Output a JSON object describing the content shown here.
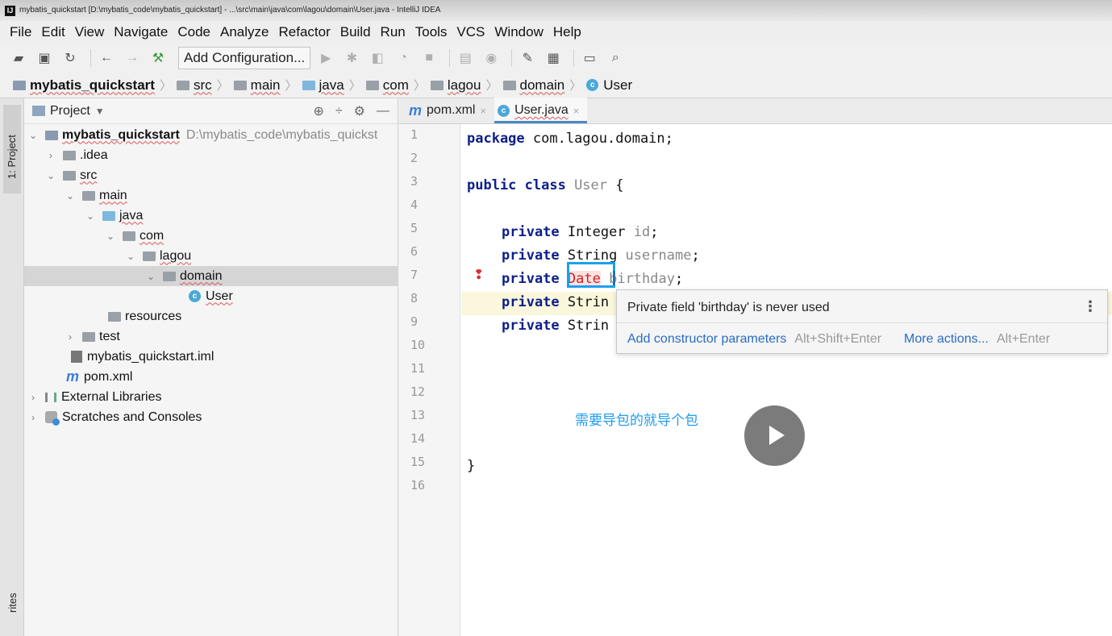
{
  "window": {
    "title": "mybatis_quickstart [D:\\mybatis_code\\mybatis_quickstart] - ...\\src\\main\\java\\com\\lagou\\domain\\User.java - IntelliJ IDEA"
  },
  "menu": [
    "File",
    "Edit",
    "View",
    "Navigate",
    "Code",
    "Analyze",
    "Refactor",
    "Build",
    "Run",
    "Tools",
    "VCS",
    "Window",
    "Help"
  ],
  "toolbar": {
    "run_config": "Add Configuration..."
  },
  "breadcrumb": [
    "mybatis_quickstart",
    "src",
    "main",
    "java",
    "com",
    "lagou",
    "domain",
    "User"
  ],
  "side_strip": {
    "project_tab": "1: Project",
    "bottom_tab": "rites"
  },
  "project_panel": {
    "title": "Project",
    "tree": [
      {
        "label": "mybatis_quickstart",
        "path": "D:\\mybatis_code\\mybatis_quickst"
      },
      {
        "label": ".idea"
      },
      {
        "label": "src"
      },
      {
        "label": "main"
      },
      {
        "label": "java"
      },
      {
        "label": "com"
      },
      {
        "label": "lagou"
      },
      {
        "label": "domain"
      },
      {
        "label": "User"
      },
      {
        "label": "resources"
      },
      {
        "label": "test"
      },
      {
        "label": "mybatis_quickstart.iml"
      },
      {
        "label": "pom.xml"
      },
      {
        "label": "External Libraries"
      },
      {
        "label": "Scratches and Consoles"
      }
    ]
  },
  "editor": {
    "tabs": [
      "pom.xml",
      "User.java"
    ],
    "line_numbers": [
      "1",
      "2",
      "3",
      "4",
      "5",
      "6",
      "7",
      "8",
      "9",
      "10",
      "11",
      "12",
      "13",
      "14",
      "15",
      "16"
    ],
    "code": {
      "l1_kw": "package",
      "l1_rest": " com.lagou.domain;",
      "l3_kw": "public class",
      "l3_name": " User",
      "l3_rest": " {",
      "l5_kw": "private",
      "l5_type": " Integer ",
      "l5_field": "id",
      "l5_end": ";",
      "l6_kw": "private",
      "l6_type": " String ",
      "l6_field": "username",
      "l6_end": ";",
      "l7_kw": "private",
      "l7_type": "Date",
      "l7_field": " birthday",
      "l7_end": ";",
      "l8_kw": "private",
      "l8_type": " Strin",
      "l9_kw": "private",
      "l9_type": " Strin",
      "l15": "}"
    }
  },
  "popup": {
    "message": "Private field 'birthday' is never used",
    "more_icon": "⋮",
    "action1": "Add constructor parameters",
    "action1_shortcut": "Alt+Shift+Enter",
    "action2": "More actions...",
    "action2_shortcut": "Alt+Enter"
  },
  "overlay": {
    "subtitle": "需要导包的就导个包"
  },
  "colors": {
    "accent": "#4a88c7",
    "error": "#d62020",
    "highlight_box": "#1ea0ef",
    "keyword": "#0c1f8a"
  }
}
